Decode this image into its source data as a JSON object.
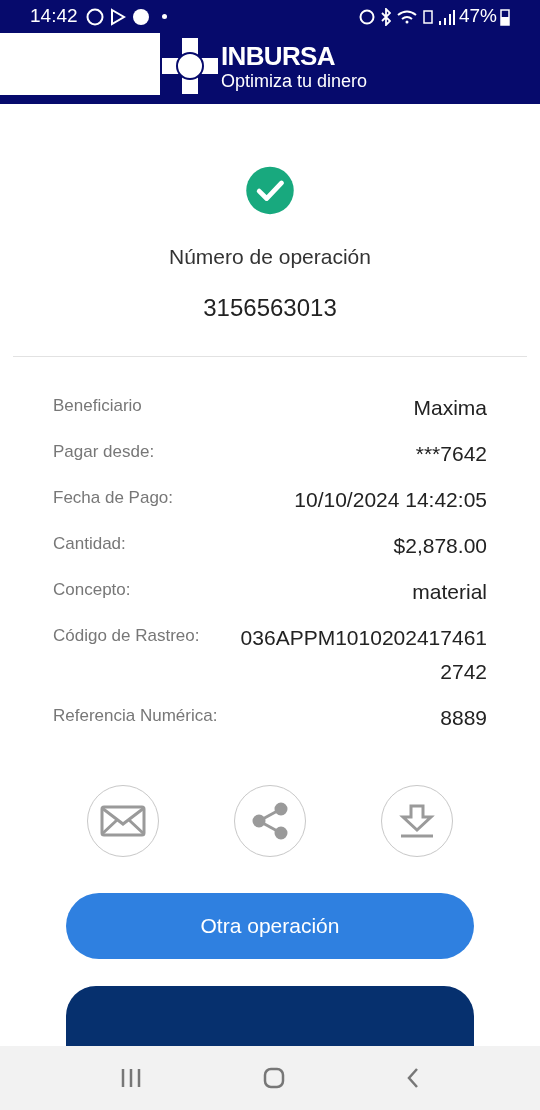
{
  "status_bar": {
    "time": "14:42",
    "battery": "47%"
  },
  "header": {
    "brand": "INBURSA",
    "tagline": "Optimiza tu dinero"
  },
  "result": {
    "label": "Número de operación",
    "number": "3156563013"
  },
  "details": [
    {
      "label": "Beneficiario",
      "value": [
        "Maxima"
      ]
    },
    {
      "label": "Pagar desde:",
      "value": [
        "***7642"
      ]
    },
    {
      "label": "Fecha de Pago:",
      "value": [
        "10/10/2024 14:42:05"
      ]
    },
    {
      "label": "Cantidad:",
      "value": [
        "$2,878.00"
      ]
    },
    {
      "label": "Concepto:",
      "value": [
        "material"
      ]
    },
    {
      "label": "Código de Rastreo:",
      "value": [
        "036APPM1010202417461",
        "2742"
      ]
    },
    {
      "label": "Referencia Numérica:",
      "value": [
        "8889"
      ]
    }
  ],
  "actions": [
    {
      "kind": "email"
    },
    {
      "kind": "share"
    },
    {
      "kind": "download"
    }
  ],
  "primary_button": "Otra operación"
}
